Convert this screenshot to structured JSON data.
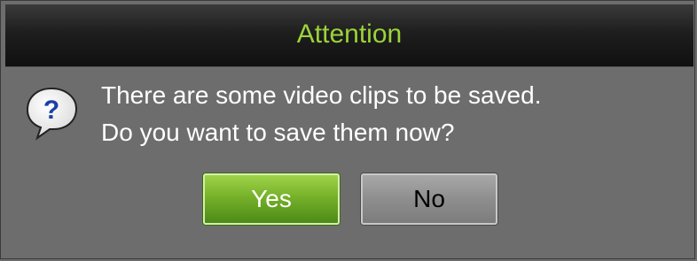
{
  "dialog": {
    "title": "Attention",
    "icon": "question-icon",
    "message_lines": [
      "There are some video clips to be saved.",
      "Do you want to save them now?"
    ],
    "buttons": {
      "yes_label": "Yes",
      "no_label": "No"
    }
  },
  "colors": {
    "title_text": "#9bd33a",
    "dialog_bg": "#6d6d6d",
    "yes_button": "#77b12a",
    "no_button": "#8e8e8e"
  }
}
